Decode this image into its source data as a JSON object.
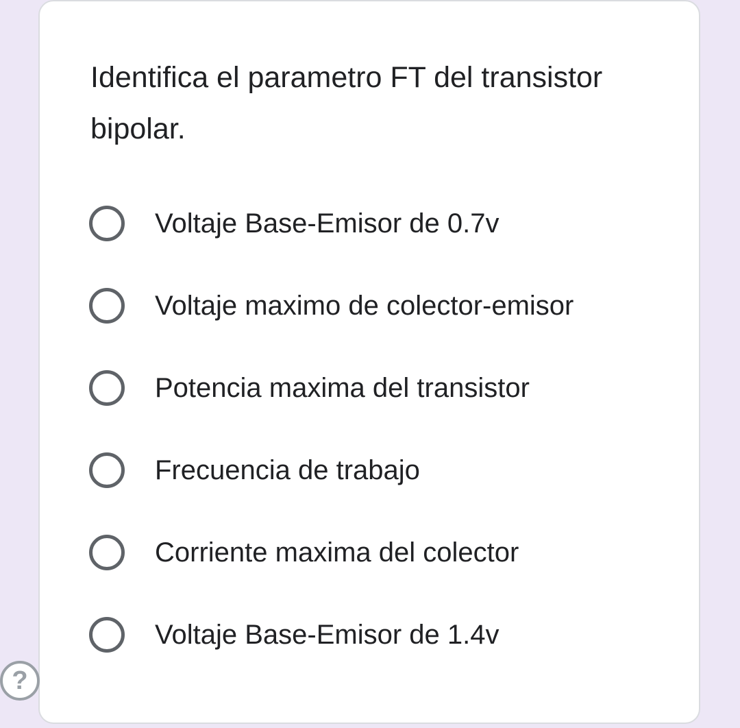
{
  "question": {
    "text": "Identifica el parametro FT del transistor bipolar."
  },
  "options": [
    {
      "label": "Voltaje Base-Emisor de 0.7v",
      "selected": false
    },
    {
      "label": "Voltaje maximo de colector-emisor",
      "selected": false
    },
    {
      "label": "Potencia maxima del transistor",
      "selected": false
    },
    {
      "label": "Frecuencia de trabajo",
      "selected": false
    },
    {
      "label": "Corriente maxima del colector",
      "selected": false
    },
    {
      "label": "Voltaje Base-Emisor de 1.4v",
      "selected": false
    }
  ],
  "help": {
    "glyph": "?",
    "icon": "question-mark-circle-icon"
  },
  "colors": {
    "page_background": "#ede7f6",
    "card_background": "#ffffff",
    "text": "#202124",
    "radio_border": "#5f6368",
    "help_icon": "#9aa0a6"
  }
}
